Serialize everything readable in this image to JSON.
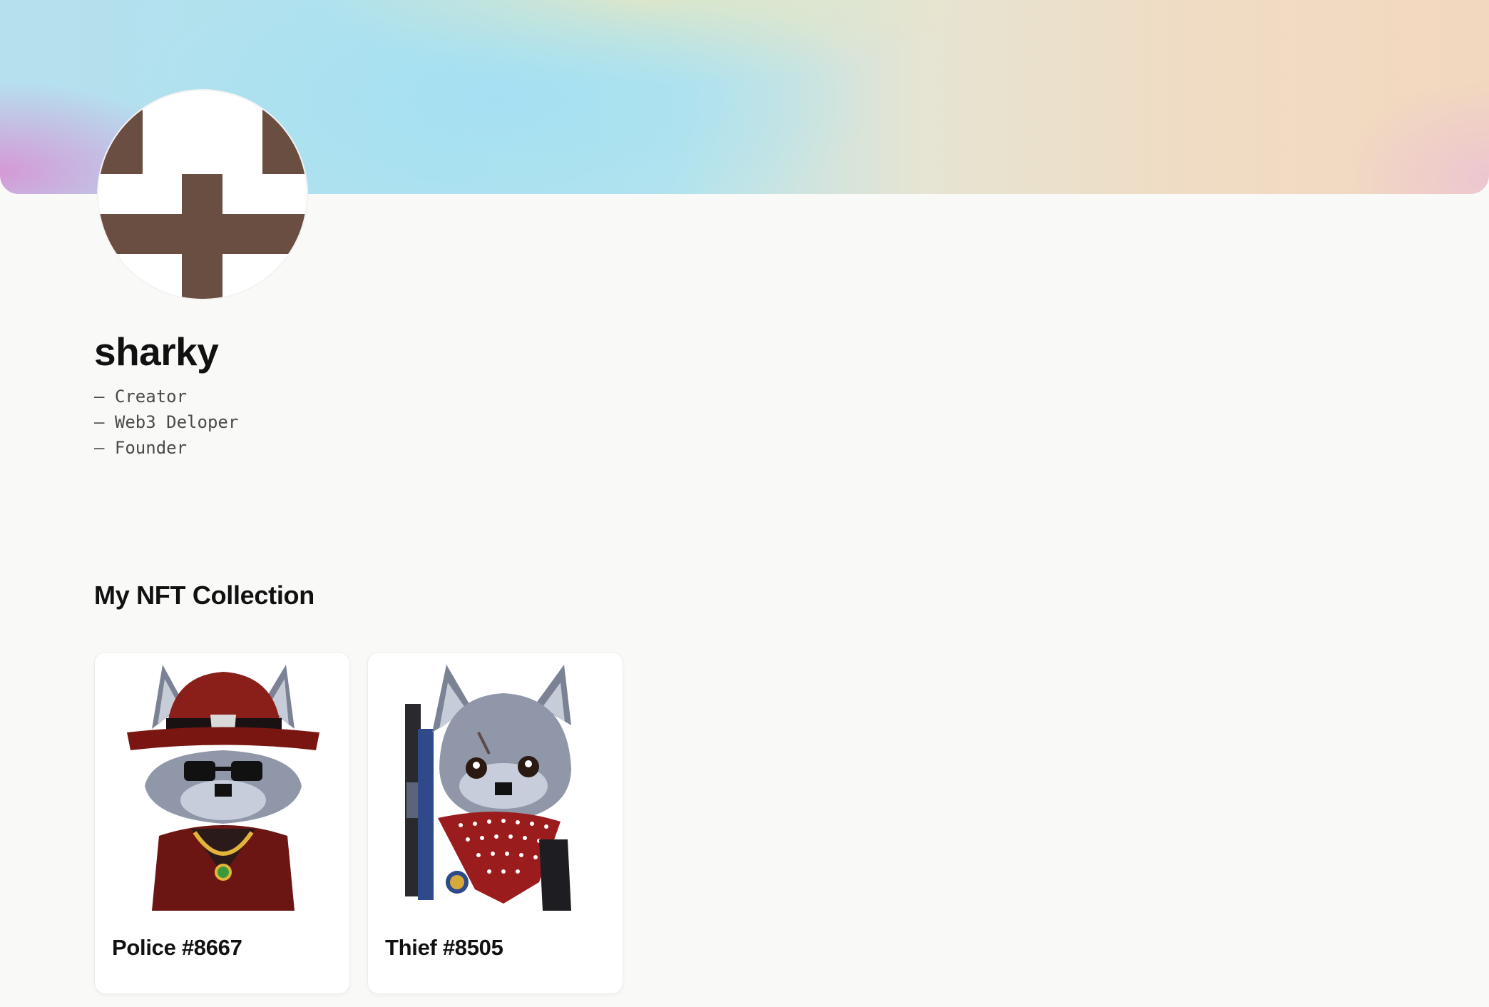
{
  "profile": {
    "name": "sharky",
    "bio": [
      "– Creator",
      "– Web3 Deloper",
      "– Founder"
    ]
  },
  "colors": {
    "background": "#f9f9f7",
    "avatar_pattern": "#6b4e42"
  },
  "collection": {
    "title": "My NFT Collection",
    "items": [
      {
        "title": "Police #8667",
        "image": "wolf-police-pixel-art"
      },
      {
        "title": "Thief #8505",
        "image": "wolf-thief-pixel-art"
      }
    ]
  }
}
